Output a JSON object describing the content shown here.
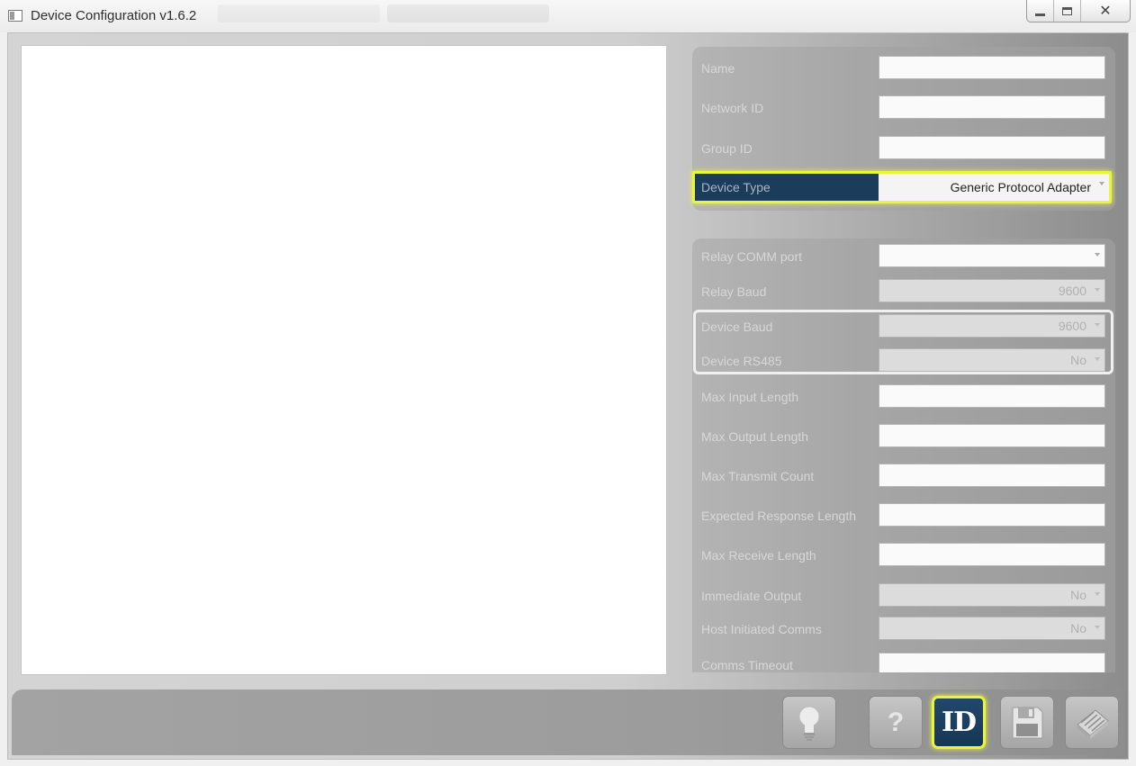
{
  "window": {
    "title": "Device Configuration v1.6.2",
    "controls": {
      "minimize": "",
      "maximize": "",
      "close": "✕"
    }
  },
  "device_panel": {
    "name": {
      "label": "Name",
      "value": ""
    },
    "network_id": {
      "label": "Network ID",
      "value": ""
    },
    "group_id": {
      "label": "Group ID",
      "value": ""
    },
    "device_type": {
      "label": "Device Type",
      "value": "Generic Protocol Adapter"
    }
  },
  "comm_panel": {
    "relay_comm_port": {
      "label": "Relay COMM port",
      "value": ""
    },
    "relay_baud": {
      "label": "Relay Baud",
      "value": "9600"
    },
    "device_baud": {
      "label": "Device Baud",
      "value": "9600"
    },
    "device_rs485": {
      "label": "Device RS485",
      "value": "No"
    },
    "max_input_length": {
      "label": "Max Input Length",
      "value": ""
    },
    "max_output_length": {
      "label": "Max Output Length",
      "value": ""
    },
    "max_transmit_count": {
      "label": "Max Transmit Count",
      "value": ""
    },
    "expected_response_length": {
      "label": "Expected Response Length",
      "value": ""
    },
    "max_receive_length": {
      "label": "Max Receive Length",
      "value": ""
    },
    "immediate_output": {
      "label": "Immediate Output",
      "value": "No"
    },
    "host_initiated_comms": {
      "label": "Host Initiated Comms",
      "value": "No"
    },
    "comms_timeout": {
      "label": "Comms Timeout",
      "value": ""
    }
  },
  "toolbar": {
    "help_label": "?",
    "id_label": "ID"
  },
  "colors": {
    "highlight": "#e8f53a",
    "active_navy": "#1c3c5c"
  }
}
